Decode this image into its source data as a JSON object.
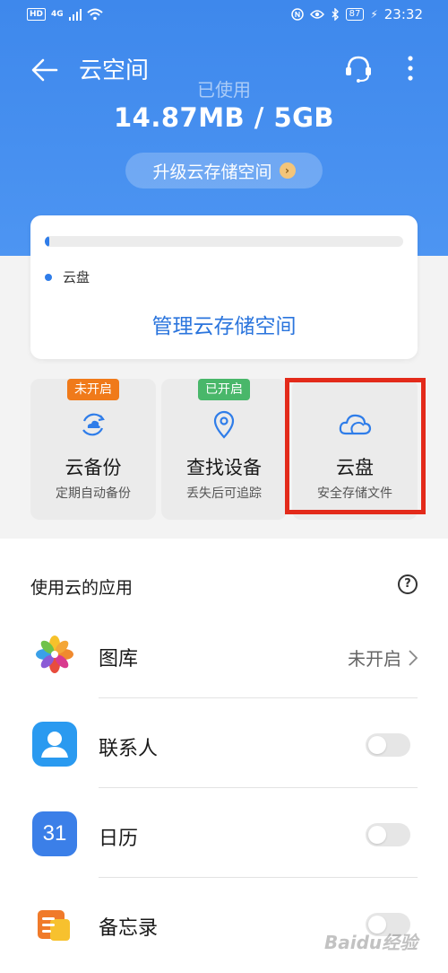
{
  "status_bar": {
    "network_badge": "HD",
    "network_type": "4G",
    "battery": "87",
    "time": "23:32"
  },
  "header": {
    "title": "云空间",
    "used_label": "已使用",
    "used_value": "14.87MB / 5GB",
    "upgrade_label": "升级云存储空间"
  },
  "storage": {
    "usage_fraction": 0.003,
    "legend": "云盘",
    "manage_label": "管理云存储空间",
    "accent_color": "#2f7de9"
  },
  "tiles": [
    {
      "badge": "未开启",
      "badge_color": "#f07a1a",
      "title": "云备份",
      "subtitle": "定期自动备份",
      "icon": "cloud-sync-icon"
    },
    {
      "badge": "已开启",
      "badge_color": "#49b76a",
      "title": "查找设备",
      "subtitle": "丢失后可追踪",
      "icon": "location-pin-icon"
    },
    {
      "badge": "",
      "title": "云盘",
      "subtitle": "安全存储文件",
      "icon": "cloud-icon"
    }
  ],
  "apps": {
    "header": "使用云的应用",
    "help_icon": "question-circle-icon",
    "items": [
      {
        "name": "图库",
        "status": "未开启",
        "icon": "gallery-icon"
      },
      {
        "name": "联系人",
        "toggle": false,
        "icon": "contacts-icon"
      },
      {
        "name": "日历",
        "toggle": false,
        "icon": "calendar-icon",
        "icon_text": "31"
      },
      {
        "name": "备忘录",
        "toggle": false,
        "icon": "notepad-icon"
      }
    ]
  },
  "watermark": "Baidu经验"
}
